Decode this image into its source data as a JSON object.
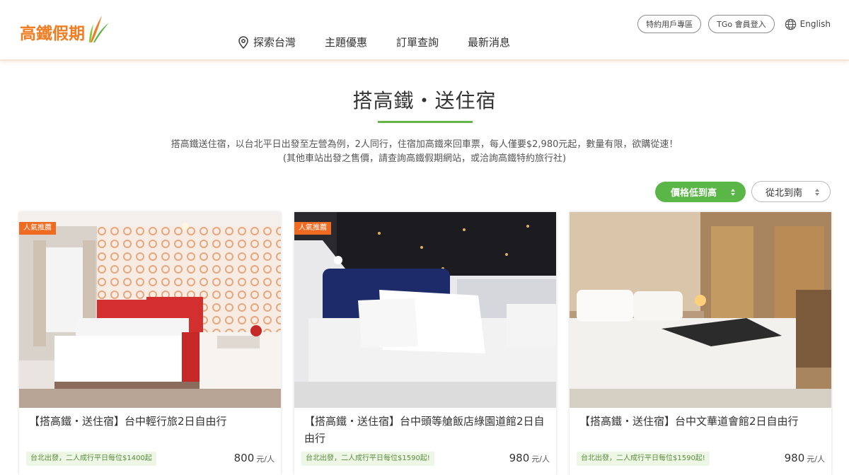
{
  "header": {
    "logo_text": "高鐵假期",
    "nav": [
      "探索台灣",
      "主題優惠",
      "訂單查詢",
      "最新消息"
    ],
    "util": {
      "partner": "特約用戶專區",
      "login": "TGo 會員登入",
      "lang": "English"
    }
  },
  "main": {
    "title": "搭高鐵・送住宿",
    "desc_line1": "搭高鐵送住宿，以台北平日出發至左營為例，2人同行，住宿加高鐵來回車票，每人僅要$2,980元起，數量有限，欲購從速！",
    "desc_line2": "(其他車站出發之售價，請查詢高鐵假期網站，或洽詢高鐵特約旅行社)"
  },
  "sort": {
    "price": "價格低到高",
    "direction": "從北到南"
  },
  "cards": [
    {
      "badge": "人氣推薦",
      "title": "【搭高鐵・送住宿】台中輕行旅2日自由行",
      "tag": "台北出發，二人成行平日每位$1400起",
      "price": "800",
      "unit": "元/人"
    },
    {
      "badge": "人氣推薦",
      "title": "【搭高鐵・送住宿】台中頭等艙飯店綠園道館2日自由行",
      "tag": "台北出發，二人成行平日每位$1590起!",
      "price": "980",
      "unit": "元/人"
    },
    {
      "badge": "",
      "title": "【搭高鐵・送住宿】台中文華道會館2日自由行",
      "tag": "台北出發，二人成行平日每位$1590起!",
      "price": "980",
      "unit": "元/人"
    }
  ],
  "colors": {
    "brand_orange": "#f07d22",
    "brand_green": "#5ab646",
    "badge_orange": "#ef6b21"
  }
}
